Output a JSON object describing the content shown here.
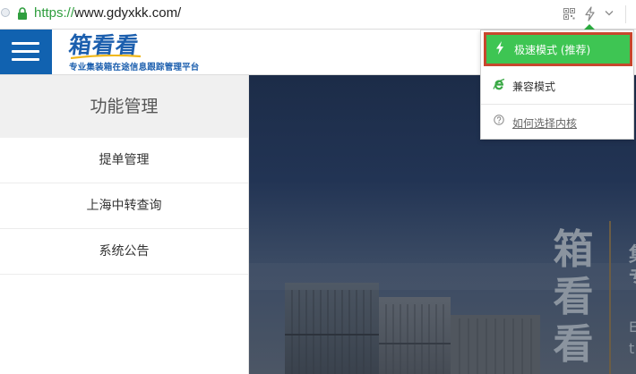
{
  "browser": {
    "url_scheme": "https://",
    "url_host": "www.gdyxkk.com/",
    "icons": {
      "security": "lock-icon",
      "qr": "qr-code-icon",
      "kernel": "lightning-bolt-icon",
      "menu": "chevron-down-icon"
    },
    "accent_color": "#2aab3f"
  },
  "kernel_menu": {
    "items": [
      {
        "label": "极速模式 (推荐)",
        "icon": "lightning-bolt-icon",
        "selected": true
      },
      {
        "label": "兼容模式",
        "icon": "ie-logo-icon",
        "selected": false
      },
      {
        "label": "如何选择内核",
        "icon": "help-circle-icon",
        "selected": false
      }
    ],
    "selected_color": "#3ec553",
    "highlight_border_color": "#c7472d"
  },
  "header": {
    "menu_icon": "hamburger-menu-icon",
    "menu_color": "#1162b0",
    "logo_title": "箱看看",
    "logo_subtitle": "专业集装箱在途信息跟踪管理平台"
  },
  "sidebar": {
    "title": "功能管理",
    "items": [
      {
        "label": "提单管理"
      },
      {
        "label": "上海中转查询"
      },
      {
        "label": "系统公告"
      }
    ]
  },
  "hero": {
    "brand_chars": [
      "箱",
      "看",
      "看"
    ],
    "side_chars": [
      "集",
      "专",
      "E",
      "t"
    ]
  }
}
